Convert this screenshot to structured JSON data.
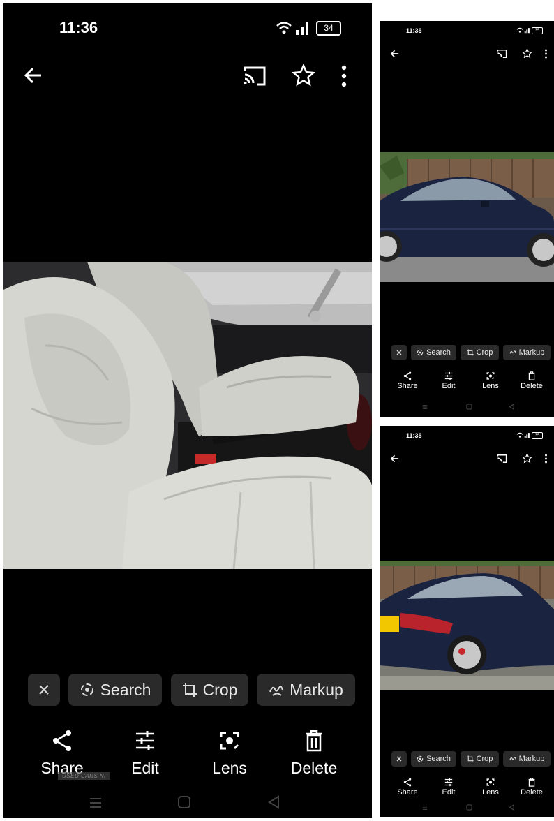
{
  "main_phone": {
    "status": {
      "time": "11:36",
      "battery": "34"
    },
    "chips": {
      "search": "Search",
      "crop": "Crop",
      "markup": "Markup"
    },
    "actions": {
      "share": "Share",
      "edit": "Edit",
      "lens": "Lens",
      "delete": "Delete"
    },
    "watermark": "USED CARS NI"
  },
  "top_phone": {
    "status": {
      "time": "11:35",
      "battery": "35"
    },
    "chips": {
      "search": "Search",
      "crop": "Crop",
      "markup": "Markup"
    },
    "actions": {
      "share": "Share",
      "edit": "Edit",
      "lens": "Lens",
      "delete": "Delete"
    }
  },
  "bottom_phone": {
    "status": {
      "time": "11:35",
      "battery": "35"
    },
    "chips": {
      "search": "Search",
      "crop": "Crop",
      "markup": "Markup"
    },
    "actions": {
      "share": "Share",
      "edit": "Edit",
      "lens": "Lens",
      "delete": "Delete"
    }
  },
  "colors": {
    "background": "#000000",
    "chip": "#2a2a2a",
    "car_body": "#1a2340",
    "seat": "#cfcfca"
  },
  "icons": [
    "back-arrow-icon",
    "cast-icon",
    "star-icon",
    "more-vert-icon",
    "close-icon",
    "lens-search-icon",
    "crop-icon",
    "markup-icon",
    "share-icon",
    "edit-icon",
    "lens-icon",
    "delete-icon",
    "wifi-icon",
    "signal-icon",
    "battery-icon"
  ]
}
